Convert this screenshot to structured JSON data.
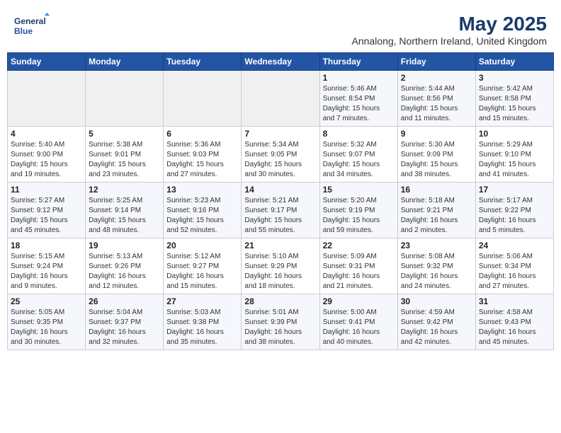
{
  "logo": {
    "line1": "General",
    "line2": "Blue"
  },
  "title": "May 2025",
  "subtitle": "Annalong, Northern Ireland, United Kingdom",
  "days_of_week": [
    "Sunday",
    "Monday",
    "Tuesday",
    "Wednesday",
    "Thursday",
    "Friday",
    "Saturday"
  ],
  "weeks": [
    [
      {
        "num": "",
        "info": ""
      },
      {
        "num": "",
        "info": ""
      },
      {
        "num": "",
        "info": ""
      },
      {
        "num": "",
        "info": ""
      },
      {
        "num": "1",
        "info": "Sunrise: 5:46 AM\nSunset: 8:54 PM\nDaylight: 15 hours\nand 7 minutes."
      },
      {
        "num": "2",
        "info": "Sunrise: 5:44 AM\nSunset: 8:56 PM\nDaylight: 15 hours\nand 11 minutes."
      },
      {
        "num": "3",
        "info": "Sunrise: 5:42 AM\nSunset: 8:58 PM\nDaylight: 15 hours\nand 15 minutes."
      }
    ],
    [
      {
        "num": "4",
        "info": "Sunrise: 5:40 AM\nSunset: 9:00 PM\nDaylight: 15 hours\nand 19 minutes."
      },
      {
        "num": "5",
        "info": "Sunrise: 5:38 AM\nSunset: 9:01 PM\nDaylight: 15 hours\nand 23 minutes."
      },
      {
        "num": "6",
        "info": "Sunrise: 5:36 AM\nSunset: 9:03 PM\nDaylight: 15 hours\nand 27 minutes."
      },
      {
        "num": "7",
        "info": "Sunrise: 5:34 AM\nSunset: 9:05 PM\nDaylight: 15 hours\nand 30 minutes."
      },
      {
        "num": "8",
        "info": "Sunrise: 5:32 AM\nSunset: 9:07 PM\nDaylight: 15 hours\nand 34 minutes."
      },
      {
        "num": "9",
        "info": "Sunrise: 5:30 AM\nSunset: 9:09 PM\nDaylight: 15 hours\nand 38 minutes."
      },
      {
        "num": "10",
        "info": "Sunrise: 5:29 AM\nSunset: 9:10 PM\nDaylight: 15 hours\nand 41 minutes."
      }
    ],
    [
      {
        "num": "11",
        "info": "Sunrise: 5:27 AM\nSunset: 9:12 PM\nDaylight: 15 hours\nand 45 minutes."
      },
      {
        "num": "12",
        "info": "Sunrise: 5:25 AM\nSunset: 9:14 PM\nDaylight: 15 hours\nand 48 minutes."
      },
      {
        "num": "13",
        "info": "Sunrise: 5:23 AM\nSunset: 9:16 PM\nDaylight: 15 hours\nand 52 minutes."
      },
      {
        "num": "14",
        "info": "Sunrise: 5:21 AM\nSunset: 9:17 PM\nDaylight: 15 hours\nand 55 minutes."
      },
      {
        "num": "15",
        "info": "Sunrise: 5:20 AM\nSunset: 9:19 PM\nDaylight: 15 hours\nand 59 minutes."
      },
      {
        "num": "16",
        "info": "Sunrise: 5:18 AM\nSunset: 9:21 PM\nDaylight: 16 hours\nand 2 minutes."
      },
      {
        "num": "17",
        "info": "Sunrise: 5:17 AM\nSunset: 9:22 PM\nDaylight: 16 hours\nand 5 minutes."
      }
    ],
    [
      {
        "num": "18",
        "info": "Sunrise: 5:15 AM\nSunset: 9:24 PM\nDaylight: 16 hours\nand 9 minutes."
      },
      {
        "num": "19",
        "info": "Sunrise: 5:13 AM\nSunset: 9:26 PM\nDaylight: 16 hours\nand 12 minutes."
      },
      {
        "num": "20",
        "info": "Sunrise: 5:12 AM\nSunset: 9:27 PM\nDaylight: 16 hours\nand 15 minutes."
      },
      {
        "num": "21",
        "info": "Sunrise: 5:10 AM\nSunset: 9:29 PM\nDaylight: 16 hours\nand 18 minutes."
      },
      {
        "num": "22",
        "info": "Sunrise: 5:09 AM\nSunset: 9:31 PM\nDaylight: 16 hours\nand 21 minutes."
      },
      {
        "num": "23",
        "info": "Sunrise: 5:08 AM\nSunset: 9:32 PM\nDaylight: 16 hours\nand 24 minutes."
      },
      {
        "num": "24",
        "info": "Sunrise: 5:06 AM\nSunset: 9:34 PM\nDaylight: 16 hours\nand 27 minutes."
      }
    ],
    [
      {
        "num": "25",
        "info": "Sunrise: 5:05 AM\nSunset: 9:35 PM\nDaylight: 16 hours\nand 30 minutes."
      },
      {
        "num": "26",
        "info": "Sunrise: 5:04 AM\nSunset: 9:37 PM\nDaylight: 16 hours\nand 32 minutes."
      },
      {
        "num": "27",
        "info": "Sunrise: 5:03 AM\nSunset: 9:38 PM\nDaylight: 16 hours\nand 35 minutes."
      },
      {
        "num": "28",
        "info": "Sunrise: 5:01 AM\nSunset: 9:39 PM\nDaylight: 16 hours\nand 38 minutes."
      },
      {
        "num": "29",
        "info": "Sunrise: 5:00 AM\nSunset: 9:41 PM\nDaylight: 16 hours\nand 40 minutes."
      },
      {
        "num": "30",
        "info": "Sunrise: 4:59 AM\nSunset: 9:42 PM\nDaylight: 16 hours\nand 42 minutes."
      },
      {
        "num": "31",
        "info": "Sunrise: 4:58 AM\nSunset: 9:43 PM\nDaylight: 16 hours\nand 45 minutes."
      }
    ]
  ]
}
